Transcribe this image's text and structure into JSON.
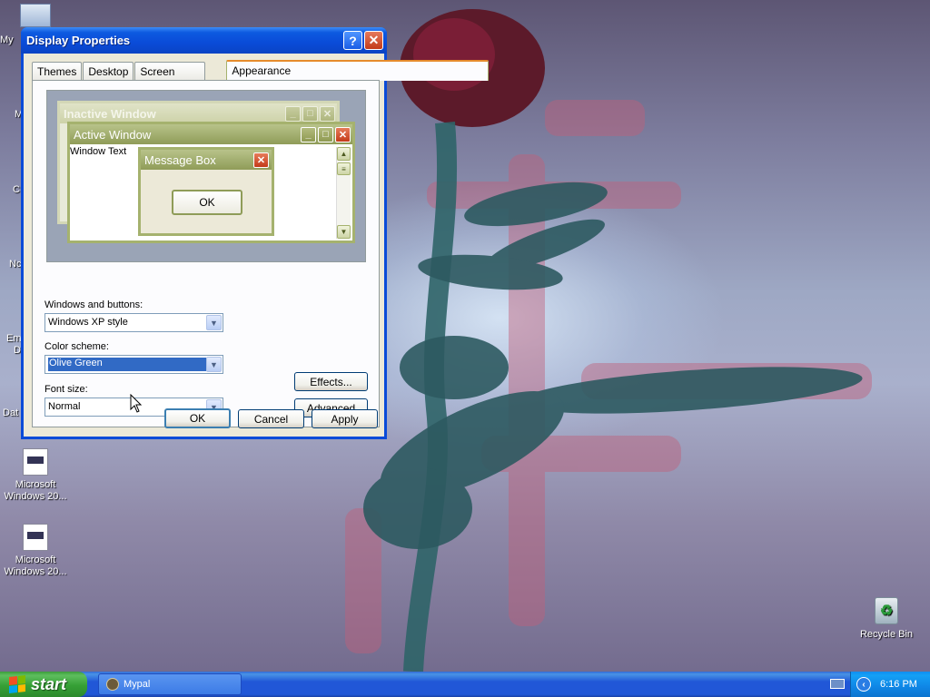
{
  "dialog": {
    "title": "Display Properties",
    "help_glyph": "?",
    "close_glyph": "✕",
    "tabs": [
      "Themes",
      "Desktop",
      "Screen Saver",
      "Appearance"
    ],
    "active_tab": "Appearance",
    "preview": {
      "inactive_title": "Inactive Window",
      "active_title": "Active Window",
      "window_text": "Window Text",
      "message_title": "Message Box",
      "ok_label": "OK",
      "min_glyph": "_",
      "max_glyph": "□",
      "close_glyph": "✕"
    },
    "windows_buttons": {
      "label": "Windows and buttons:",
      "value": "Windows XP style"
    },
    "color_scheme": {
      "label": "Color scheme:",
      "value": "Olive Green"
    },
    "font_size": {
      "label": "Font size:",
      "value": "Normal"
    },
    "effects_label": "Effects...",
    "advanced_label": "Advanced",
    "ok_label": "OK",
    "cancel_label": "Cancel",
    "apply_label": "Apply"
  },
  "desktop": {
    "partial_labels": [
      "My",
      "M",
      "C",
      "Nc",
      "Em",
      "D",
      "Dat"
    ],
    "icons": [
      {
        "label": "Microsoft Windows 20..."
      },
      {
        "label": "Microsoft Windows 20..."
      }
    ],
    "recycle_bin": "Recycle Bin"
  },
  "taskbar": {
    "start_label": "start",
    "task_label": "Mypal",
    "clock": "6:16 PM",
    "chevron": "‹"
  },
  "colors": {
    "selection": "#316ac5",
    "olive_accent": "#8f9c58",
    "taskbar_blue": "#2157d7",
    "start_green": "#36a036"
  }
}
